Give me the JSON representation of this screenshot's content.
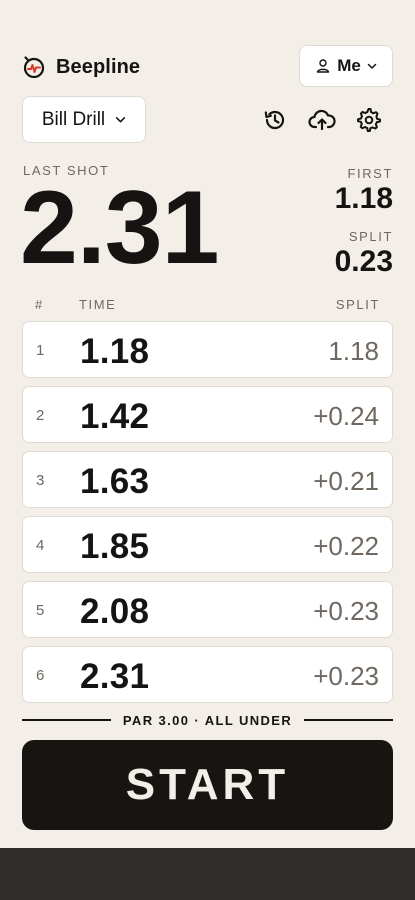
{
  "app": {
    "name": "Beepline",
    "accent_color": "#d43b2a"
  },
  "header": {
    "user_label": "Me",
    "drill_label": "Bill Drill",
    "icons": [
      "history-icon",
      "cloud-upload-icon",
      "gear-icon"
    ]
  },
  "last_shot": {
    "label": "LAST SHOT",
    "value": "2.31",
    "first_label": "FIRST",
    "first_value": "1.18",
    "split_label": "SPLIT",
    "split_value": "0.23"
  },
  "table": {
    "headers": {
      "num": "#",
      "time": "TIME",
      "split": "SPLIT"
    },
    "rows": [
      {
        "num": "1",
        "time": "1.18",
        "split": "1.18"
      },
      {
        "num": "2",
        "time": "1.42",
        "split": "+0.24"
      },
      {
        "num": "3",
        "time": "1.63",
        "split": "+0.21"
      },
      {
        "num": "4",
        "time": "1.85",
        "split": "+0.22"
      },
      {
        "num": "5",
        "time": "2.08",
        "split": "+0.23"
      },
      {
        "num": "6",
        "time": "2.31",
        "split": "+0.23"
      }
    ]
  },
  "par_text": "PAR 3.00 · ALL UNDER",
  "start_label": "START",
  "colors": {
    "background": "#f3efe8",
    "ink": "#161412",
    "muted": "#6e6860",
    "card": "#ffffff"
  }
}
